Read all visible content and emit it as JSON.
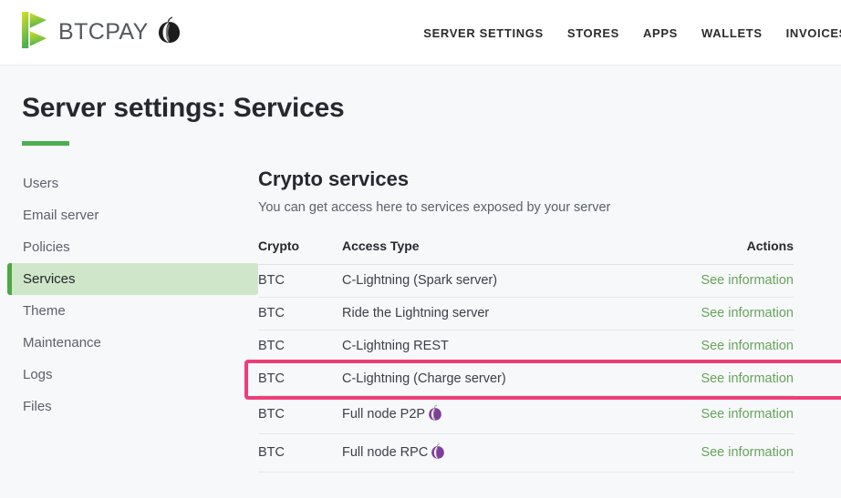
{
  "header": {
    "brand_name": "BTCPAY",
    "brand_logo_icon": "btcpay-logo-icon",
    "tor_icon": "tor-onion-icon",
    "nav": [
      {
        "label": "SERVER SETTINGS"
      },
      {
        "label": "STORES"
      },
      {
        "label": "APPS"
      },
      {
        "label": "WALLETS"
      },
      {
        "label": "INVOICES"
      }
    ]
  },
  "page": {
    "title": "Server settings: Services"
  },
  "sidebar": {
    "items": [
      {
        "label": "Users",
        "active": false
      },
      {
        "label": "Email server",
        "active": false
      },
      {
        "label": "Policies",
        "active": false
      },
      {
        "label": "Services",
        "active": true
      },
      {
        "label": "Theme",
        "active": false
      },
      {
        "label": "Maintenance",
        "active": false
      },
      {
        "label": "Logs",
        "active": false
      },
      {
        "label": "Files",
        "active": false
      }
    ]
  },
  "main": {
    "section_title": "Crypto services",
    "section_subtitle": "You can get access here to services exposed by your server",
    "table": {
      "columns": [
        "Crypto",
        "Access Type",
        "Actions"
      ],
      "rows": [
        {
          "crypto": "BTC",
          "access_type": "C-Lightning (Spark server)",
          "onion": false,
          "action": "See information",
          "highlighted": false
        },
        {
          "crypto": "BTC",
          "access_type": "Ride the Lightning server",
          "onion": false,
          "action": "See information",
          "highlighted": false
        },
        {
          "crypto": "BTC",
          "access_type": "C-Lightning REST",
          "onion": false,
          "action": "See information",
          "highlighted": false
        },
        {
          "crypto": "BTC",
          "access_type": "C-Lightning (Charge server)",
          "onion": false,
          "action": "See information",
          "highlighted": true
        },
        {
          "crypto": "BTC",
          "access_type": "Full node P2P",
          "onion": true,
          "action": "See information",
          "highlighted": false
        },
        {
          "crypto": "BTC",
          "access_type": "Full node RPC",
          "onion": true,
          "action": "See information",
          "highlighted": false
        }
      ]
    }
  },
  "colors": {
    "accent_green": "#4caf50",
    "active_nav_bg": "#cfe6c9",
    "active_nav_bar": "#4da844",
    "link_green": "#68a35c",
    "highlight_pink": "#ee3e78",
    "page_bg": "#f7f8fa",
    "header_bg": "#ffffff"
  }
}
